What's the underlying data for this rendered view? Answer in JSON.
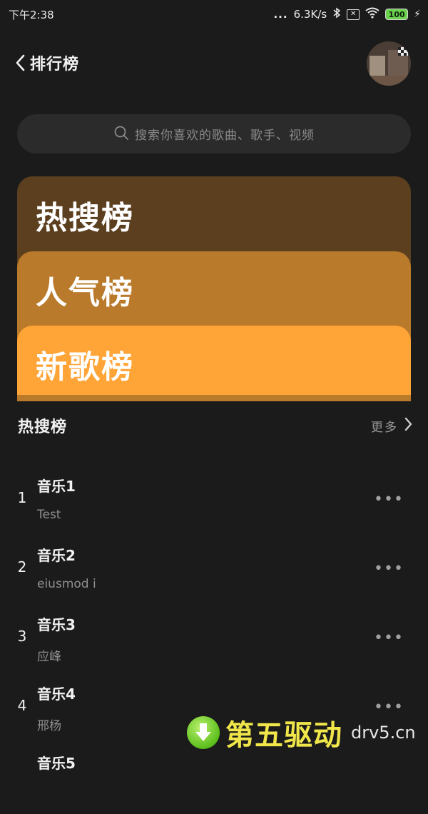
{
  "status_bar": {
    "time": "下午2:38",
    "signal_dots": "...",
    "network_speed": "6.3K/s",
    "battery": "100"
  },
  "header": {
    "title": "排行榜"
  },
  "search": {
    "placeholder": "搜索你喜欢的歌曲、歌手、视频"
  },
  "rank_cards": [
    {
      "title": "热搜榜",
      "color": "#5b3f1f"
    },
    {
      "title": "人气榜",
      "color": "#ba7a2b"
    },
    {
      "title": "新歌榜",
      "color": "#ffa436"
    }
  ],
  "section": {
    "title": "热搜榜",
    "more_label": "更多"
  },
  "songs": [
    {
      "rank": "1",
      "title": "音乐1",
      "artist": "Test"
    },
    {
      "rank": "2",
      "title": "音乐2",
      "artist": "eiusmod i"
    },
    {
      "rank": "3",
      "title": "音乐3",
      "artist": "应峰"
    },
    {
      "rank": "4",
      "title": "音乐4",
      "artist": "邢杨"
    },
    {
      "rank": "",
      "title": "音乐5",
      "artist": ""
    }
  ],
  "song_menu_glyph": "•••",
  "watermark": {
    "brand": "第五驱动",
    "domain": "drv5.cn"
  }
}
